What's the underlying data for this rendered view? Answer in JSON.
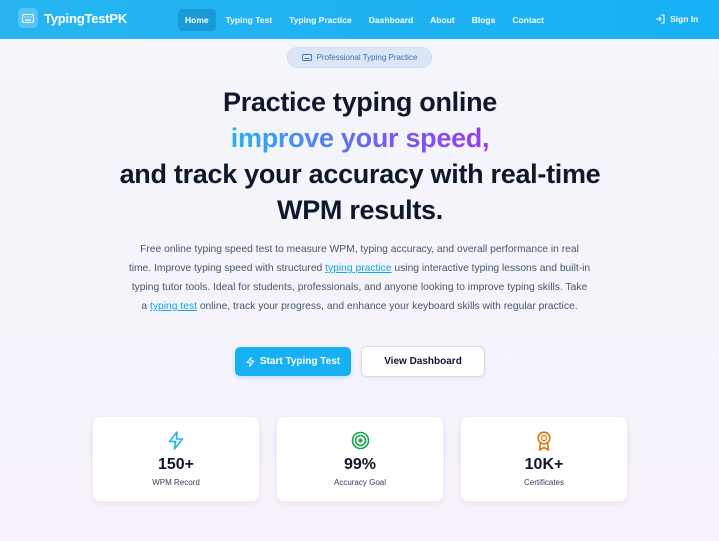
{
  "navbar": {
    "brand": "TypingTestPK",
    "links": [
      "Home",
      "Typing Test",
      "Typing Practice",
      "Dashboard",
      "About",
      "Blogs",
      "Contact"
    ],
    "active": "Home",
    "signin": "Sign In"
  },
  "badge": {
    "label": "Professional Typing Practice"
  },
  "hero": {
    "line1": "Practice typing online",
    "line2": "improve your speed,",
    "line3": "and track your accuracy with real-time",
    "line4": "WPM results.",
    "desc_part1": "Free online typing speed test to measure WPM, typing accuracy, and overall performance in real time. Improve typing speed with structured ",
    "link1": "typing practice",
    "desc_part2": " using interactive typing lessons and built-in typing tutor tools. Ideal for students, professionals, and anyone looking to improve typing skills. Take a ",
    "link2": "typing test",
    "desc_part3": " online, track your progress, and enhance your keyboard skills with regular practice."
  },
  "buttons": {
    "primary": "Start Typing Test",
    "secondary": "View Dashboard"
  },
  "stats": [
    {
      "value": "150+",
      "label": "WPM Record",
      "icon": "lightning-icon",
      "color": "#1fb3ef"
    },
    {
      "value": "99%",
      "label": "Accuracy Goal",
      "icon": "target-icon",
      "color": "#16a34a"
    },
    {
      "value": "10K+",
      "label": "Certificates",
      "icon": "award-icon",
      "color": "#d97706"
    }
  ],
  "colors": {
    "navbar": "#17b1f5",
    "accent": "#0ea5e9"
  }
}
